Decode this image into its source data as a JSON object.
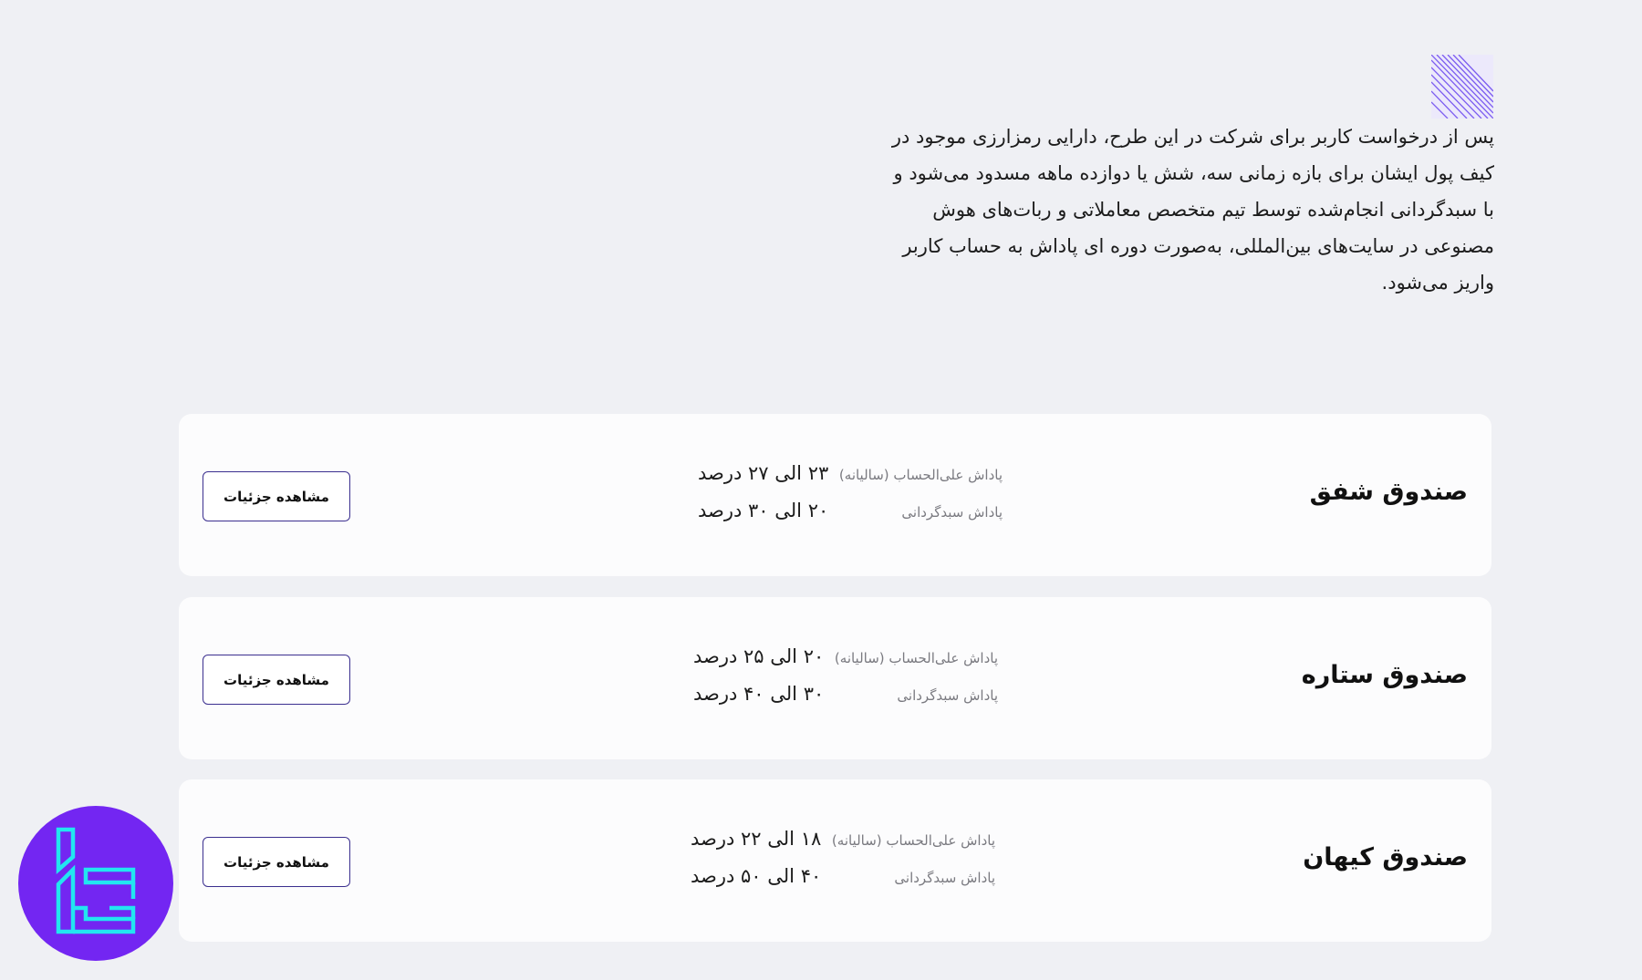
{
  "intro": {
    "icon": "striped-triangle-icon",
    "lines": [
      "پس از درخواست کاربر برای شرکت در این طرح، دارایی رمزارزی موجود در",
      "کیف پول ایشان برای بازه زمانی سه، شش یا دوازده ماهه مسدود می‌شود و",
      "با سبدگردانی انجام‌شده توسط تیم متخصص معاملاتی و ربات‌های هوش",
      "مصنوعی در سایت‌های بین‌المللی، به‌صورت دوره ای پاداش به حساب کاربر",
      "واریز می‌شود."
    ]
  },
  "funds": [
    {
      "title": "صندوق شفق",
      "rows": [
        {
          "label": "پاداش علی‌الحساب (سالیانه)",
          "value": "۲۳ الی ۲۷ درصد"
        },
        {
          "label": "پاداش سبدگردانی",
          "value": "۲۰ الی ۳۰ درصد"
        }
      ],
      "button": "مشاهده جزئیات"
    },
    {
      "title": "صندوق ستاره",
      "rows": [
        {
          "label": "پاداش علی‌الحساب (سالیانه)",
          "value": "۲۰ الی ۲۵ درصد"
        },
        {
          "label": "پاداش سبدگردانی",
          "value": "۳۰ الی ۴۰ درصد"
        }
      ],
      "button": "مشاهده جزئیات"
    },
    {
      "title": "صندوق کیهان",
      "rows": [
        {
          "label": "پاداش علی‌الحساب (سالیانه)",
          "value": "۱۸ الی ۲۲ درصد"
        },
        {
          "label": "پاداش سبدگردانی",
          "value": "۴۰ الی ۵۰ درصد"
        }
      ],
      "button": "مشاهده جزئیات"
    }
  ],
  "logo": {
    "icon": "brand-logo-icon",
    "bg_color": "#7326f2",
    "mark_color": "#22e6f0"
  },
  "colors": {
    "page_bg": "#eff0f4",
    "card_bg": "#fcfcfd",
    "button_border": "#3b2f8f"
  }
}
